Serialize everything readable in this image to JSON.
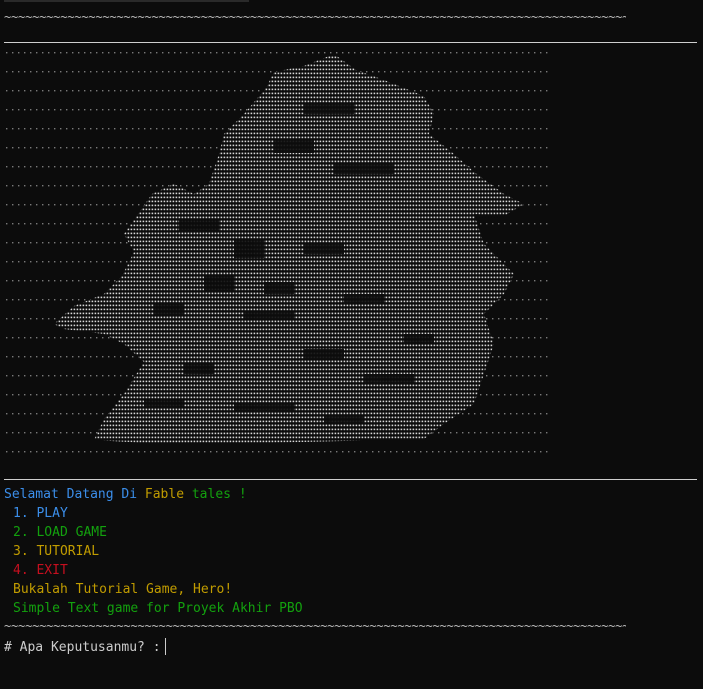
{
  "tilde_line": "~~~~~~~~~~~~~~~~~~~~~~~~~~~~~~~~~~~~~~~~~~~~~~~~~~~~~~~~~~~~~~~~~~~~~~~~~~~~~~~~~~~~~~~~~~~~~~~~~~~~~~~~~~~~~",
  "welcome": {
    "part1": "Selamat Datang Di",
    "part2": "Fable",
    "part3": "tales !"
  },
  "menu": [
    {
      "label": "1. PLAY"
    },
    {
      "label": "2. LOAD GAME"
    },
    {
      "label": "3. TUTORIAL"
    },
    {
      "label": "4. EXIT"
    }
  ],
  "hint": "Bukalah Tutorial Game, Hero!",
  "footer": "Simple Text game for Proyek Akhir PBO",
  "prompt": "# Apa Keputusanmu? :",
  "colors": {
    "background": "#0c0c0c",
    "blue": "#3b8eea",
    "green": "#13a10e",
    "yellow": "#c19c00",
    "red": "#c50f1f"
  }
}
